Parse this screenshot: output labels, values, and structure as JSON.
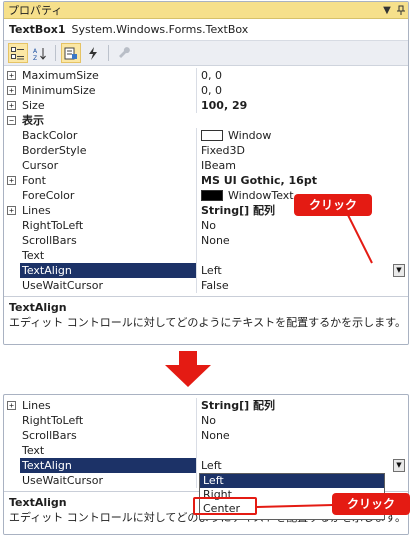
{
  "panel1": {
    "title": "プロパティ",
    "title_pin": "▼ ꟼ",
    "object_name": "TextBox1",
    "object_type": "System.Windows.Forms.TextBox",
    "rows": [
      {
        "exp": "+",
        "name": "MaximumSize",
        "value": "0, 0"
      },
      {
        "exp": "+",
        "name": "MinimumSize",
        "value": "0, 0"
      },
      {
        "exp": "+",
        "name": "Size",
        "value": "100, 29"
      },
      {
        "exp": "−",
        "name": "表示",
        "value": ""
      },
      {
        "exp": "",
        "name": "BackColor",
        "value": "Window"
      },
      {
        "exp": "",
        "name": "BorderStyle",
        "value": "Fixed3D"
      },
      {
        "exp": "",
        "name": "Cursor",
        "value": "IBeam"
      },
      {
        "exp": "+",
        "name": "Font",
        "value": "MS UI Gothic, 16pt"
      },
      {
        "exp": "",
        "name": "ForeColor",
        "value": "WindowText"
      },
      {
        "exp": "+",
        "name": "Lines",
        "value": "String[] 配列"
      },
      {
        "exp": "",
        "name": "RightToLeft",
        "value": "No"
      },
      {
        "exp": "",
        "name": "ScrollBars",
        "value": "None"
      },
      {
        "exp": "",
        "name": "Text",
        "value": ""
      },
      {
        "exp": "",
        "name": "TextAlign",
        "value": "Left"
      },
      {
        "exp": "",
        "name": "UseWaitCursor",
        "value": "False"
      }
    ],
    "desc_title": "TextAlign",
    "desc_text": "エディット コントロールに対してどのようにテキストを配置するかを示します。"
  },
  "panel2": {
    "rows": [
      {
        "exp": "+",
        "name": "Lines",
        "value": "String[] 配列"
      },
      {
        "exp": "",
        "name": "RightToLeft",
        "value": "No"
      },
      {
        "exp": "",
        "name": "ScrollBars",
        "value": "None"
      },
      {
        "exp": "",
        "name": "Text",
        "value": ""
      },
      {
        "exp": "",
        "name": "TextAlign",
        "value": "Left"
      },
      {
        "exp": "",
        "name": "UseWaitCursor",
        "value": ""
      }
    ],
    "dropdown_options": [
      "Left",
      "Right",
      "Center"
    ],
    "desc_title": "TextAlign",
    "desc_text": "エディット コントロールに対してどのようにテキストを配置するかを示します。"
  },
  "callouts": {
    "first": "クリック",
    "second": "クリック"
  },
  "colors": {
    "selection": "#1c3267",
    "callout": "#e41b13",
    "titlebar": "#f6e08b"
  }
}
